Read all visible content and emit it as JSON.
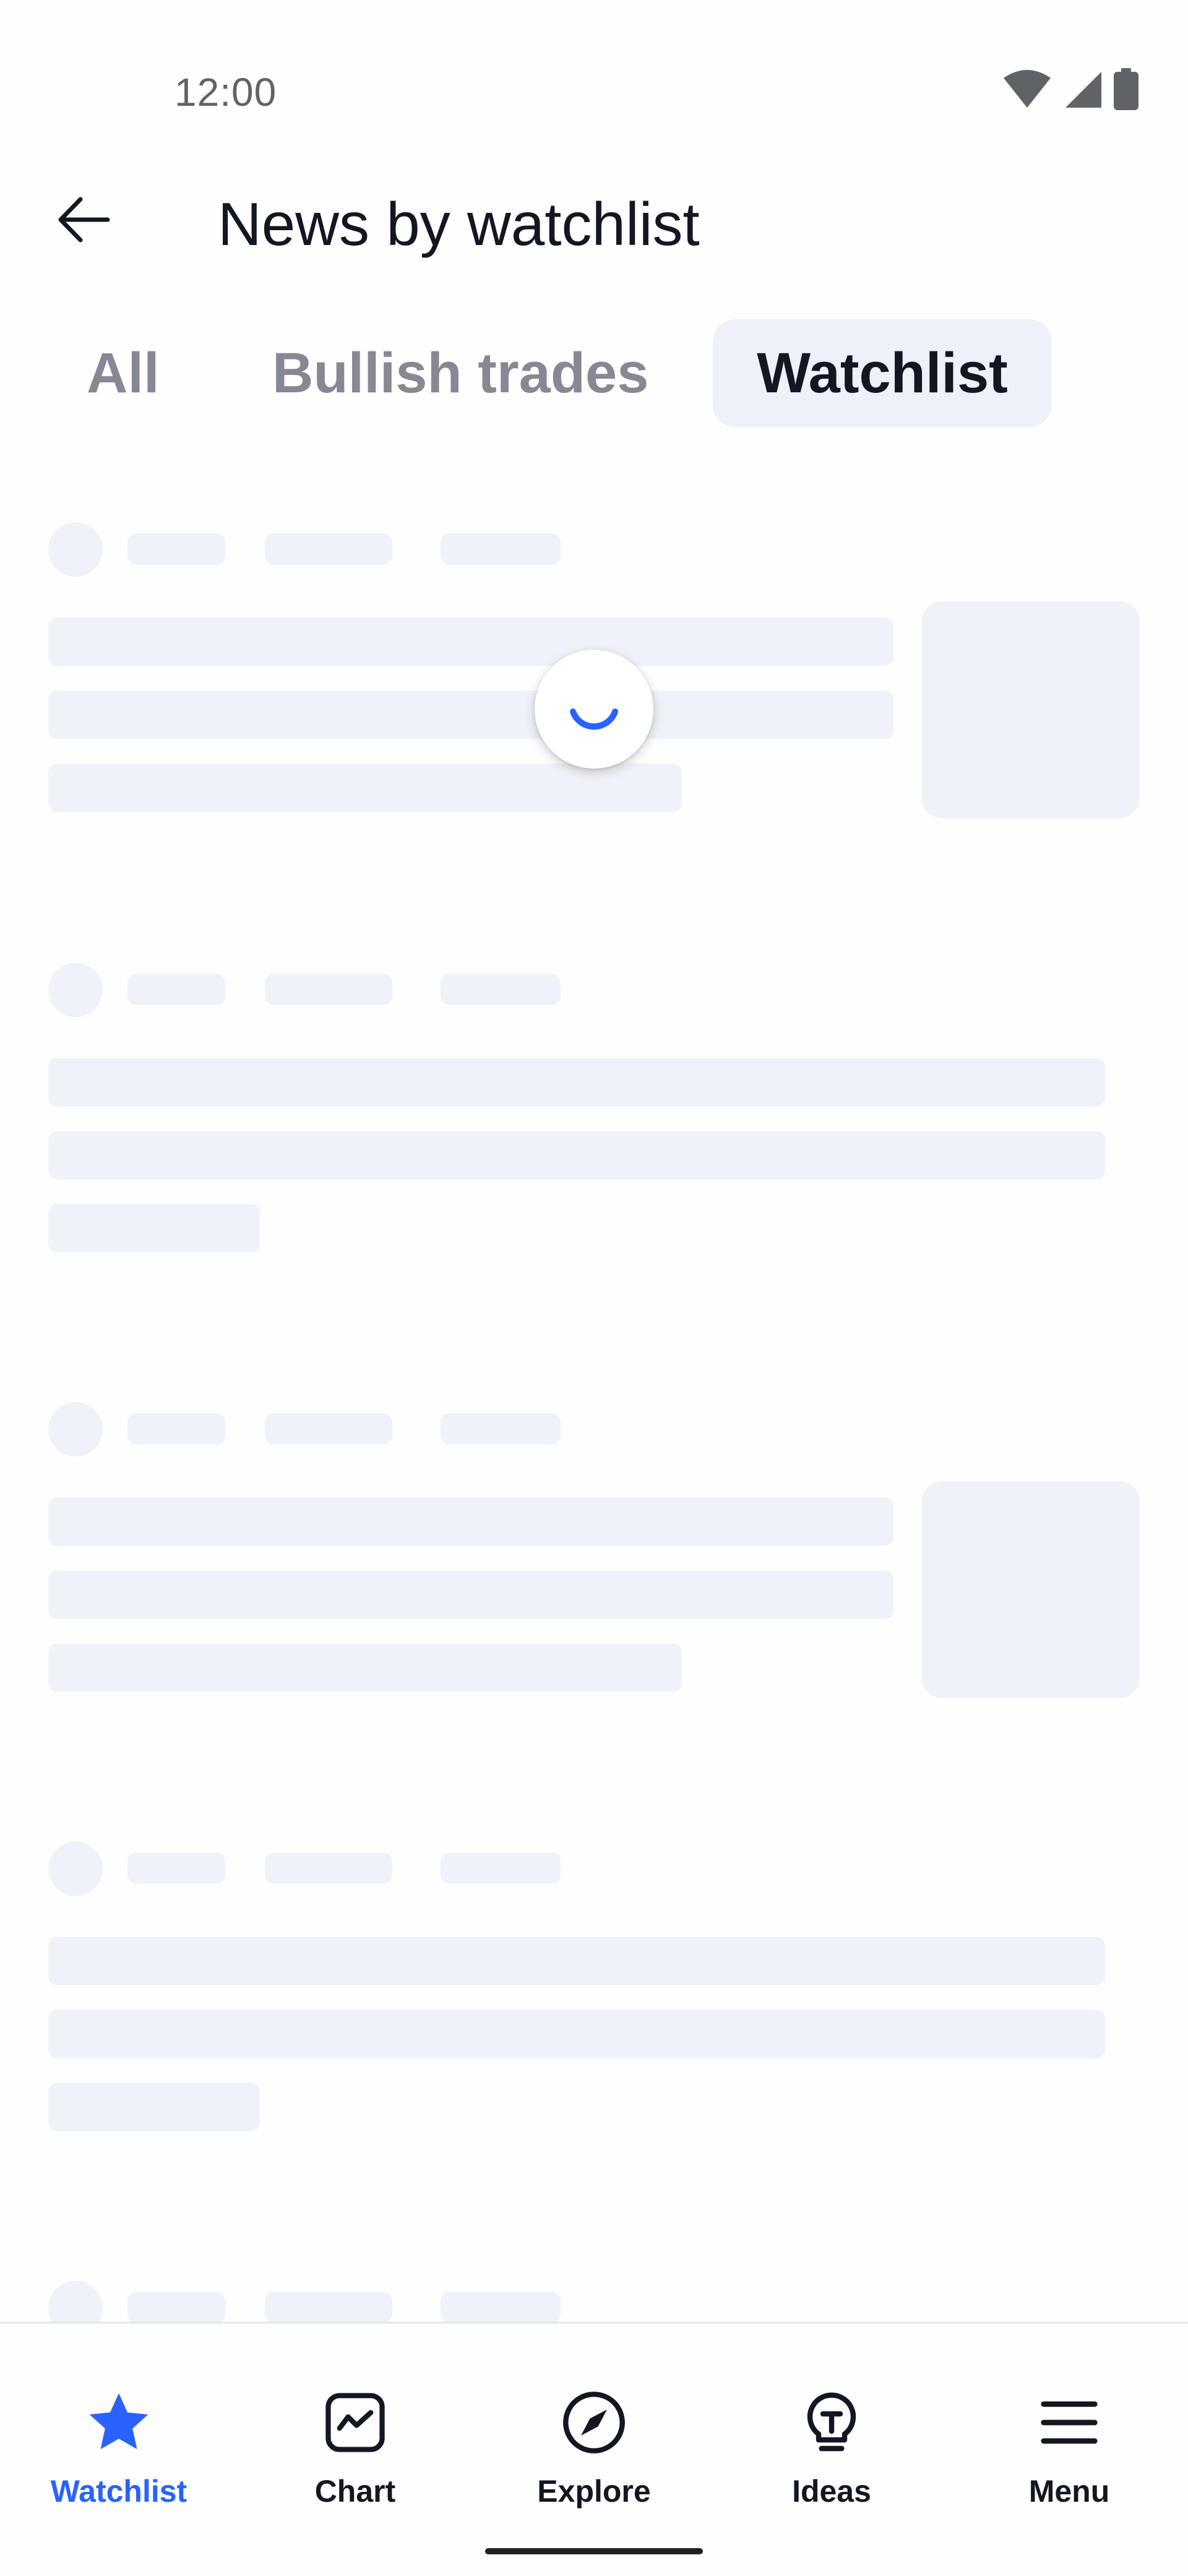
{
  "status_bar": {
    "time": "12:00",
    "icons": [
      "wifi-icon",
      "signal-icon",
      "battery-icon"
    ]
  },
  "header": {
    "back_icon": "arrow-left-icon",
    "title": "News by watchlist"
  },
  "tabs": [
    {
      "label": "All",
      "selected": false
    },
    {
      "label": "Bullish trades",
      "selected": false
    },
    {
      "label": "Watchlist",
      "selected": true
    }
  ],
  "content": {
    "state": "loading",
    "skeleton_cards": 5
  },
  "bottom_nav": {
    "items": [
      {
        "label": "Watchlist",
        "icon": "star-icon",
        "active": true
      },
      {
        "label": "Chart",
        "icon": "chart-icon",
        "active": false
      },
      {
        "label": "Explore",
        "icon": "compass-icon",
        "active": false
      },
      {
        "label": "Ideas",
        "icon": "lightbulb-icon",
        "active": false
      },
      {
        "label": "Menu",
        "icon": "hamburger-menu-icon",
        "active": false
      }
    ]
  },
  "colors": {
    "accent": "#2962ff",
    "text_primary": "#131722",
    "text_muted": "#868993",
    "skeleton": "#eff2f8",
    "tab_selected_bg": "#eff1f8"
  }
}
